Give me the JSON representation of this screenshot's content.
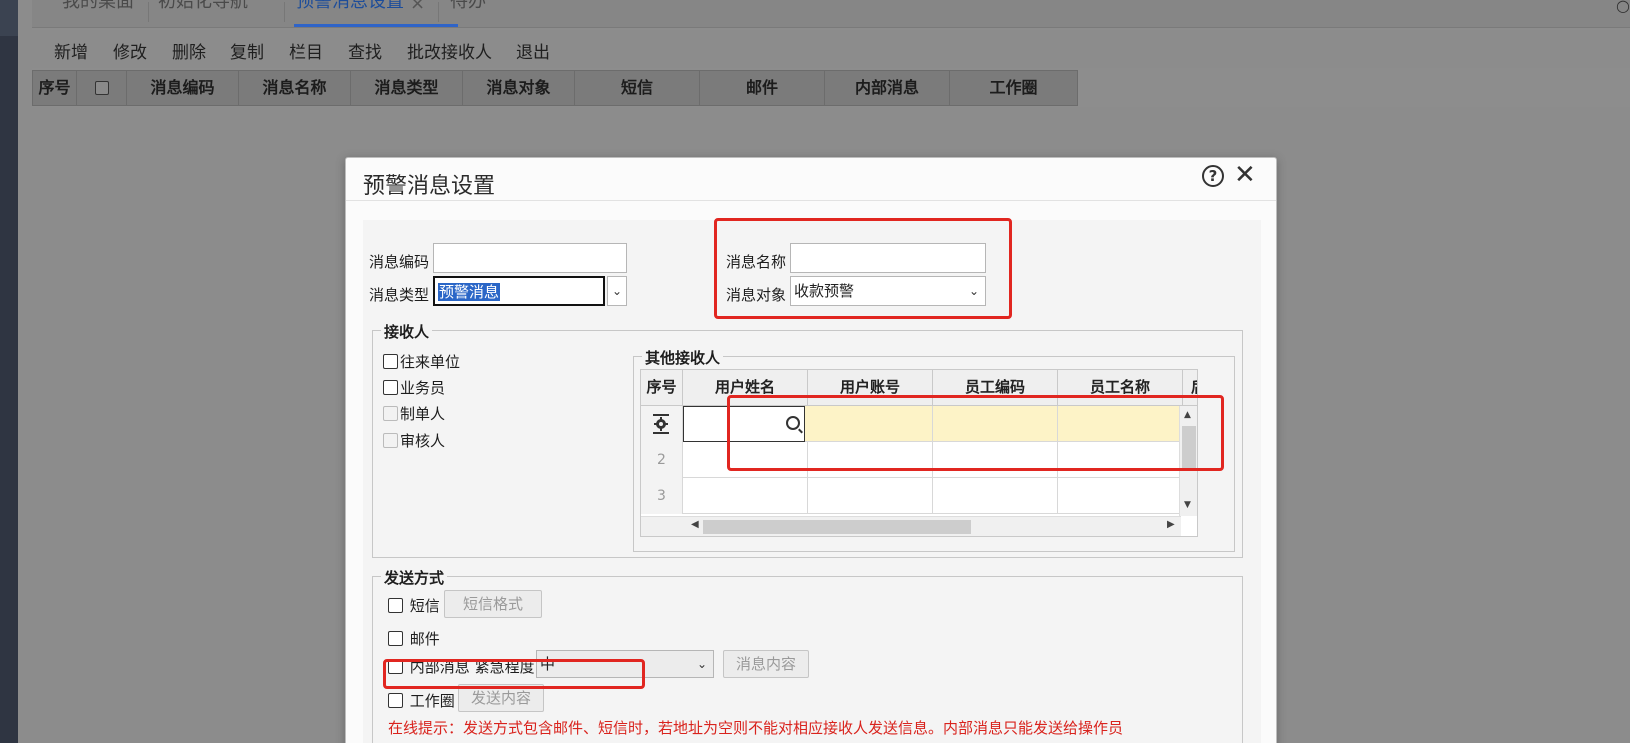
{
  "tabs": [
    {
      "label": "我的桌面"
    },
    {
      "label": "初始化导航"
    },
    {
      "label": "预警消息设置",
      "active": true
    },
    {
      "label": "待办"
    }
  ],
  "tab_close_glyph": "×",
  "toolbar": [
    "新增",
    "修改",
    "删除",
    "复制",
    "栏目",
    "查找",
    "批改接收人",
    "退出"
  ],
  "grid_columns": [
    "序号",
    "",
    "消息编码",
    "消息名称",
    "消息类型",
    "消息对象",
    "短信",
    "邮件",
    "内部消息",
    "工作圈"
  ],
  "dialog": {
    "title": "预警消息设置",
    "help_glyph": "?",
    "close_glyph": "✕",
    "fields": {
      "code_label": "消息编码",
      "code_value": "",
      "name_label": "消息名称",
      "name_value": "",
      "type_label": "消息类型",
      "type_value": "预警消息",
      "target_label": "消息对象",
      "target_value": "收款预警"
    },
    "receivers": {
      "legend": "接收人",
      "options": [
        "往来单位",
        "业务员",
        "制单人",
        "审核人"
      ],
      "other_legend": "其他接收人",
      "columns": [
        "序号",
        "用户姓名",
        "用户账号",
        "员工编码",
        "员工名称",
        "后"
      ],
      "rows": [
        "",
        "2",
        "3"
      ]
    },
    "send": {
      "legend": "发送方式",
      "sms_label": "短信",
      "sms_button": "短信格式",
      "email_label": "邮件",
      "internal_label": "内部消息",
      "urgency_label": "紧急程度",
      "urgency_value": "中",
      "internal_button": "消息内容",
      "circle_label": "工作圈",
      "circle_button": "发送内容",
      "warning": "在线提示：发送方式包含邮件、短信时，若地址为空则不能对相应接收人发送信息。内部消息只能发送给操作员"
    }
  },
  "colors": {
    "highlight_red": "#e12620",
    "selection_blue": "#2a66c7",
    "row_yellow": "#fdf3c7",
    "active_tab": "#1d4d9a"
  }
}
